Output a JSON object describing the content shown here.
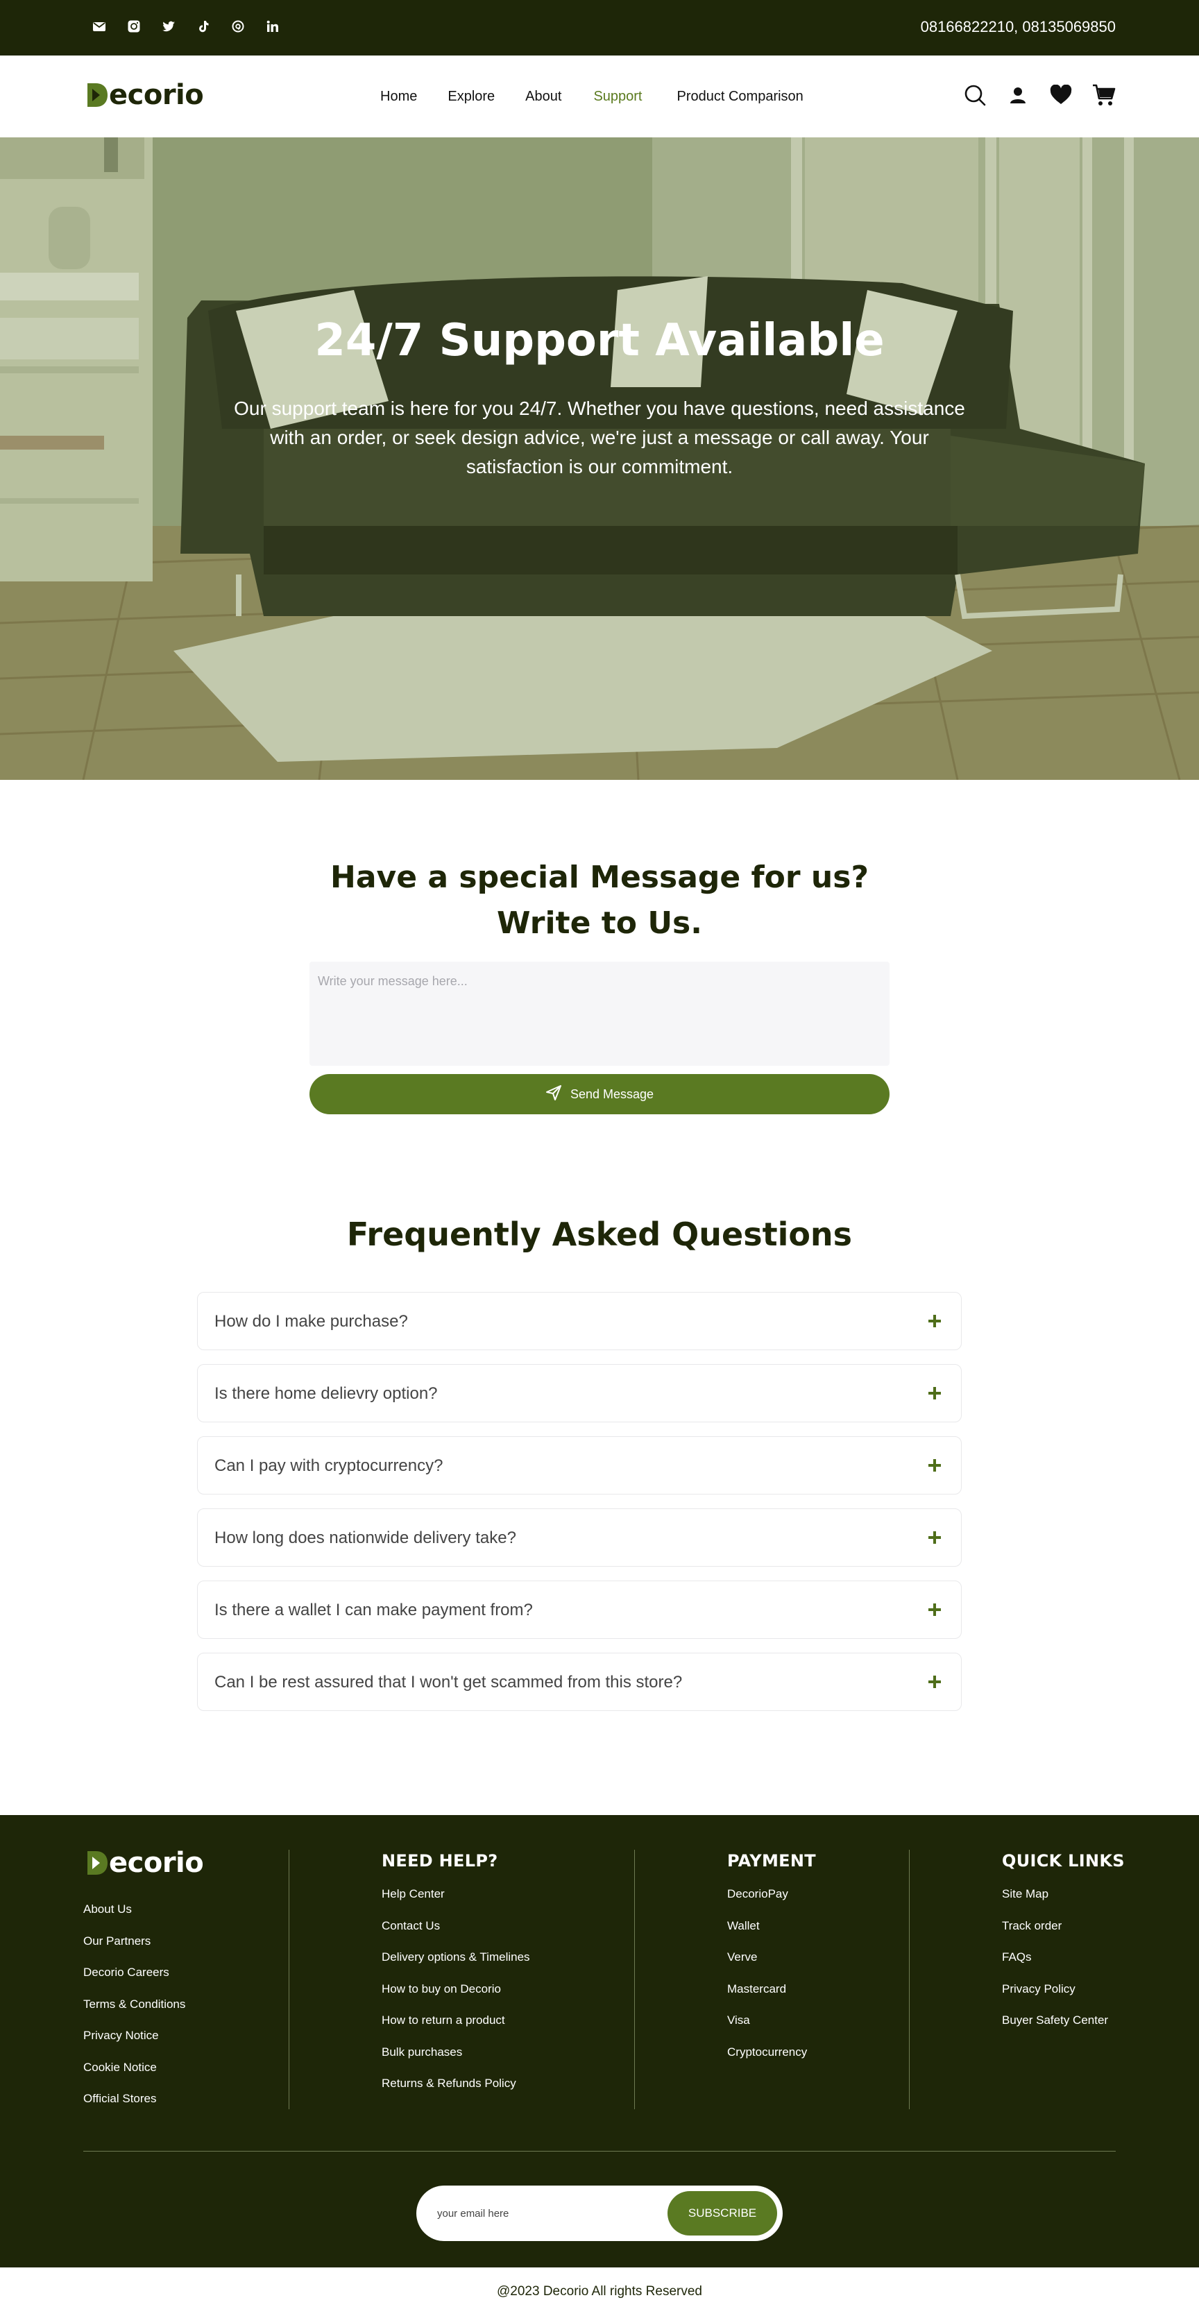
{
  "topbar": {
    "social_icons": [
      "mail-icon",
      "instagram-icon",
      "twitter-icon",
      "tiktok-icon",
      "threads-icon",
      "linkedin-icon"
    ],
    "phone": "08166822210,  08135069850"
  },
  "nav": {
    "logo_text": "ecorio",
    "logo_initial": "D",
    "links": [
      "Home",
      "Explore",
      "About",
      "Support",
      "Product Comparison"
    ],
    "active": "Support",
    "icons": [
      "search-icon",
      "user-icon",
      "heart-icon",
      "cart-icon"
    ]
  },
  "hero": {
    "title": "24/7 Support Available",
    "text": "Our support team is here for you 24/7. Whether you have questions, need assistance with an order, or seek design advice, we're just a message or call away. Your satisfaction is our commitment."
  },
  "message": {
    "title_line1": "Have a special Message for us?",
    "title_line2": "Write to Us.",
    "placeholder": "Write your message here...",
    "button": "Send Message"
  },
  "faq": {
    "title": "Frequently Asked Questions",
    "items": [
      "How do I make purchase?",
      "Is there home delievry option?",
      "Can I pay with cryptocurrency?",
      "How long does nationwide delivery take?",
      "Is there a wallet I can make payment from?",
      "Can I be rest assured that I won't get scammed from this store?"
    ]
  },
  "footer": {
    "logo_text": "ecorio",
    "logo_initial": "D",
    "company_links": [
      "About Us",
      "Our Partners",
      "Decorio Careers",
      "Terms & Conditions",
      "Privacy Notice",
      "Cookie Notice",
      "Official Stores"
    ],
    "help": {
      "title": "NEED HELP?",
      "links": [
        "Help Center",
        "Contact Us",
        "Delivery options & Timelines",
        "How to buy on Decorio",
        "How to return a product",
        "Bulk purchases",
        "Returns & Refunds Policy"
      ]
    },
    "payment": {
      "title": "PAYMENT",
      "links": [
        "DecorioPay",
        "Wallet",
        "Verve",
        "Mastercard",
        "Visa",
        "Cryptocurrency"
      ]
    },
    "quick": {
      "title": "QUICK LINKS",
      "links": [
        "Site Map",
        "Track order",
        "FAQs",
        "Privacy Policy",
        "Buyer Safety Center"
      ]
    },
    "subscribe_placeholder": "your email here",
    "subscribe_button": "SUBSCRIBE"
  },
  "copyright": "@2023 Decorio All rights Reserved",
  "colors": {
    "dark": "#1e2608",
    "accent": "#5a7a22",
    "active_link": "#5a7a1e"
  }
}
